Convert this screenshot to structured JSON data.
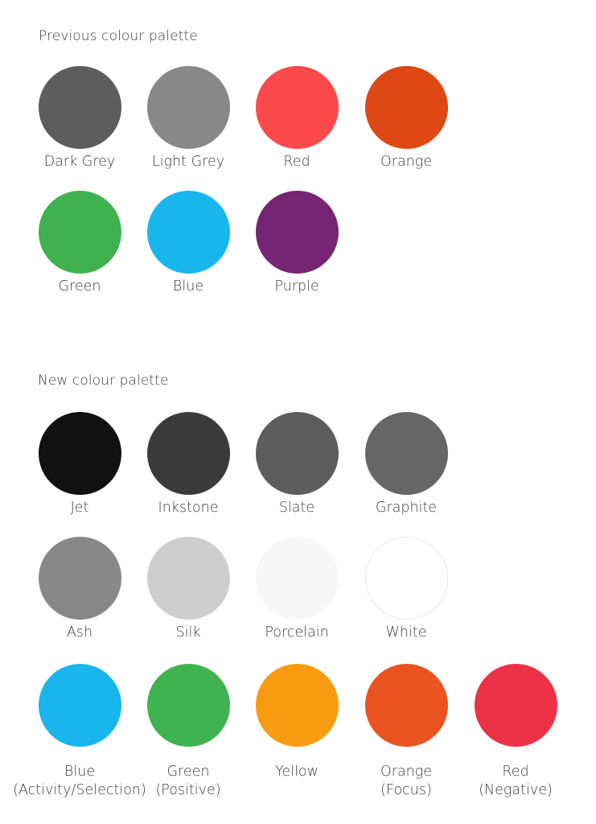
{
  "previous": {
    "heading": "Previous colour palette",
    "rows": [
      [
        {
          "name": "Dark Grey",
          "color": "#5d5d5d"
        },
        {
          "name": "Light Grey",
          "color": "#888888"
        },
        {
          "name": "Red",
          "color": "#fc4949"
        },
        {
          "name": "Orange",
          "color": "#dd4814"
        }
      ],
      [
        {
          "name": "Green",
          "color": "#3fb24f"
        },
        {
          "name": "Blue",
          "color": "#19b6ee"
        },
        {
          "name": "Purple",
          "color": "#762572"
        }
      ]
    ]
  },
  "new": {
    "heading": "New colour palette",
    "rows": [
      [
        {
          "name": "Jet",
          "color": "#111111"
        },
        {
          "name": "Inkstone",
          "color": "#3b3b3b"
        },
        {
          "name": "Slate",
          "color": "#5d5d5d"
        },
        {
          "name": "Graphite",
          "color": "#666666"
        }
      ],
      [
        {
          "name": "Ash",
          "color": "#888888"
        },
        {
          "name": "Silk",
          "color": "#cdcdcd"
        },
        {
          "name": "Porcelain",
          "color": "#f7f7f7"
        },
        {
          "name": "White",
          "color": "#ffffff",
          "outlined": true
        }
      ],
      [
        {
          "name": "Blue",
          "sub": "(Activity/Selection)",
          "color": "#19b6ee"
        },
        {
          "name": "Green",
          "sub": "(Positive)",
          "color": "#3eb34f"
        },
        {
          "name": "Yellow",
          "color": "#f99b11"
        },
        {
          "name": "Orange",
          "sub": "(Focus)",
          "color": "#e95420"
        },
        {
          "name": "Red",
          "sub": "(Negative)",
          "color": "#ed3146"
        }
      ]
    ]
  }
}
